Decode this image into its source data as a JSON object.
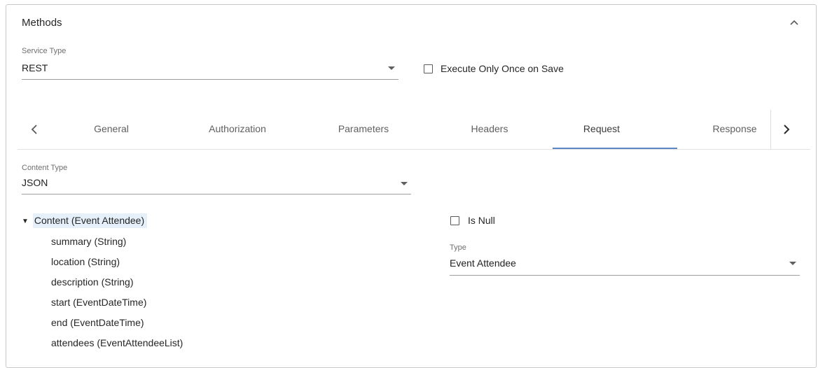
{
  "panel": {
    "title": "Methods",
    "collapse_icon": "chevron-up-icon"
  },
  "service_type": {
    "label": "Service Type",
    "value": "REST"
  },
  "execute_once": {
    "label": "Execute Only Once on Save",
    "checked": false
  },
  "tabs": {
    "prev_icon": "chevron-left-icon",
    "next_icon": "chevron-right-icon",
    "items": [
      {
        "label": "General"
      },
      {
        "label": "Authorization"
      },
      {
        "label": "Parameters"
      },
      {
        "label": "Headers"
      },
      {
        "label": "Request"
      },
      {
        "label": "Response"
      }
    ],
    "active": "Request"
  },
  "content_type": {
    "label": "Content Type",
    "value": "JSON"
  },
  "tree": {
    "expand_icon": "triangle-down-icon",
    "root": "Content (Event Attendee)",
    "children": [
      "summary (String)",
      "location (String)",
      "description (String)",
      "start (EventDateTime)",
      "end (EventDateTime)",
      "attendees (EventAttendeeList)"
    ]
  },
  "is_null": {
    "label": "Is Null",
    "checked": false
  },
  "type_select": {
    "label": "Type",
    "value": "Event Attendee"
  },
  "colors": {
    "tab_indicator": "#5b87c7",
    "selected_tree_bg": "#e6f0fa"
  }
}
